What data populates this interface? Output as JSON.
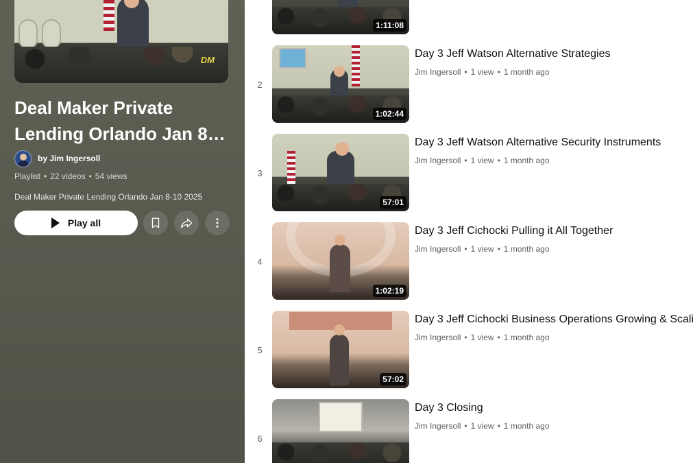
{
  "playlist": {
    "title_line1": "Deal Maker Private",
    "title_line2": "Lending Orlando Jan 8…",
    "owner": "by Jim Ingersoll",
    "type": "Playlist",
    "video_count": "22 videos",
    "views": "54 views",
    "description": "Deal Maker Private Lending Orlando Jan 8-10 2025",
    "play_all_label": "Play all",
    "hero_logo": "DM"
  },
  "videos": [
    {
      "index": "",
      "title": "",
      "channel": "",
      "views": "",
      "age": "",
      "duration": "1:11:08"
    },
    {
      "index": "2",
      "title": "Day 3 Jeff Watson Alternative Strategies",
      "channel": "Jim Ingersoll",
      "views": "1 view",
      "age": "1 month ago",
      "duration": "1:02:44"
    },
    {
      "index": "3",
      "title": "Day 3 Jeff Watson Alternative Security Instruments",
      "channel": "Jim Ingersoll",
      "views": "1 view",
      "age": "1 month ago",
      "duration": "57:01"
    },
    {
      "index": "4",
      "title": "Day 3 Jeff Cichocki Pulling it All Together",
      "channel": "Jim Ingersoll",
      "views": "1 view",
      "age": "1 month ago",
      "duration": "1:02:19"
    },
    {
      "index": "5",
      "title": "Day 3 Jeff Cichocki Business Operations Growing & Scali",
      "channel": "Jim Ingersoll",
      "views": "1 view",
      "age": "1 month ago",
      "duration": "57:02"
    },
    {
      "index": "6",
      "title": "Day 3 Closing",
      "channel": "Jim Ingersoll",
      "views": "1 view",
      "age": "1 month ago",
      "duration": ""
    }
  ],
  "separator": "•",
  "icons": {
    "play": "play-icon",
    "save": "bookmark-icon",
    "share": "share-icon",
    "more": "more-vert-icon"
  },
  "colors": {
    "sidebar_bg": "#5a5d50",
    "text_primary": "#0f0f0f",
    "text_secondary": "#606060"
  }
}
